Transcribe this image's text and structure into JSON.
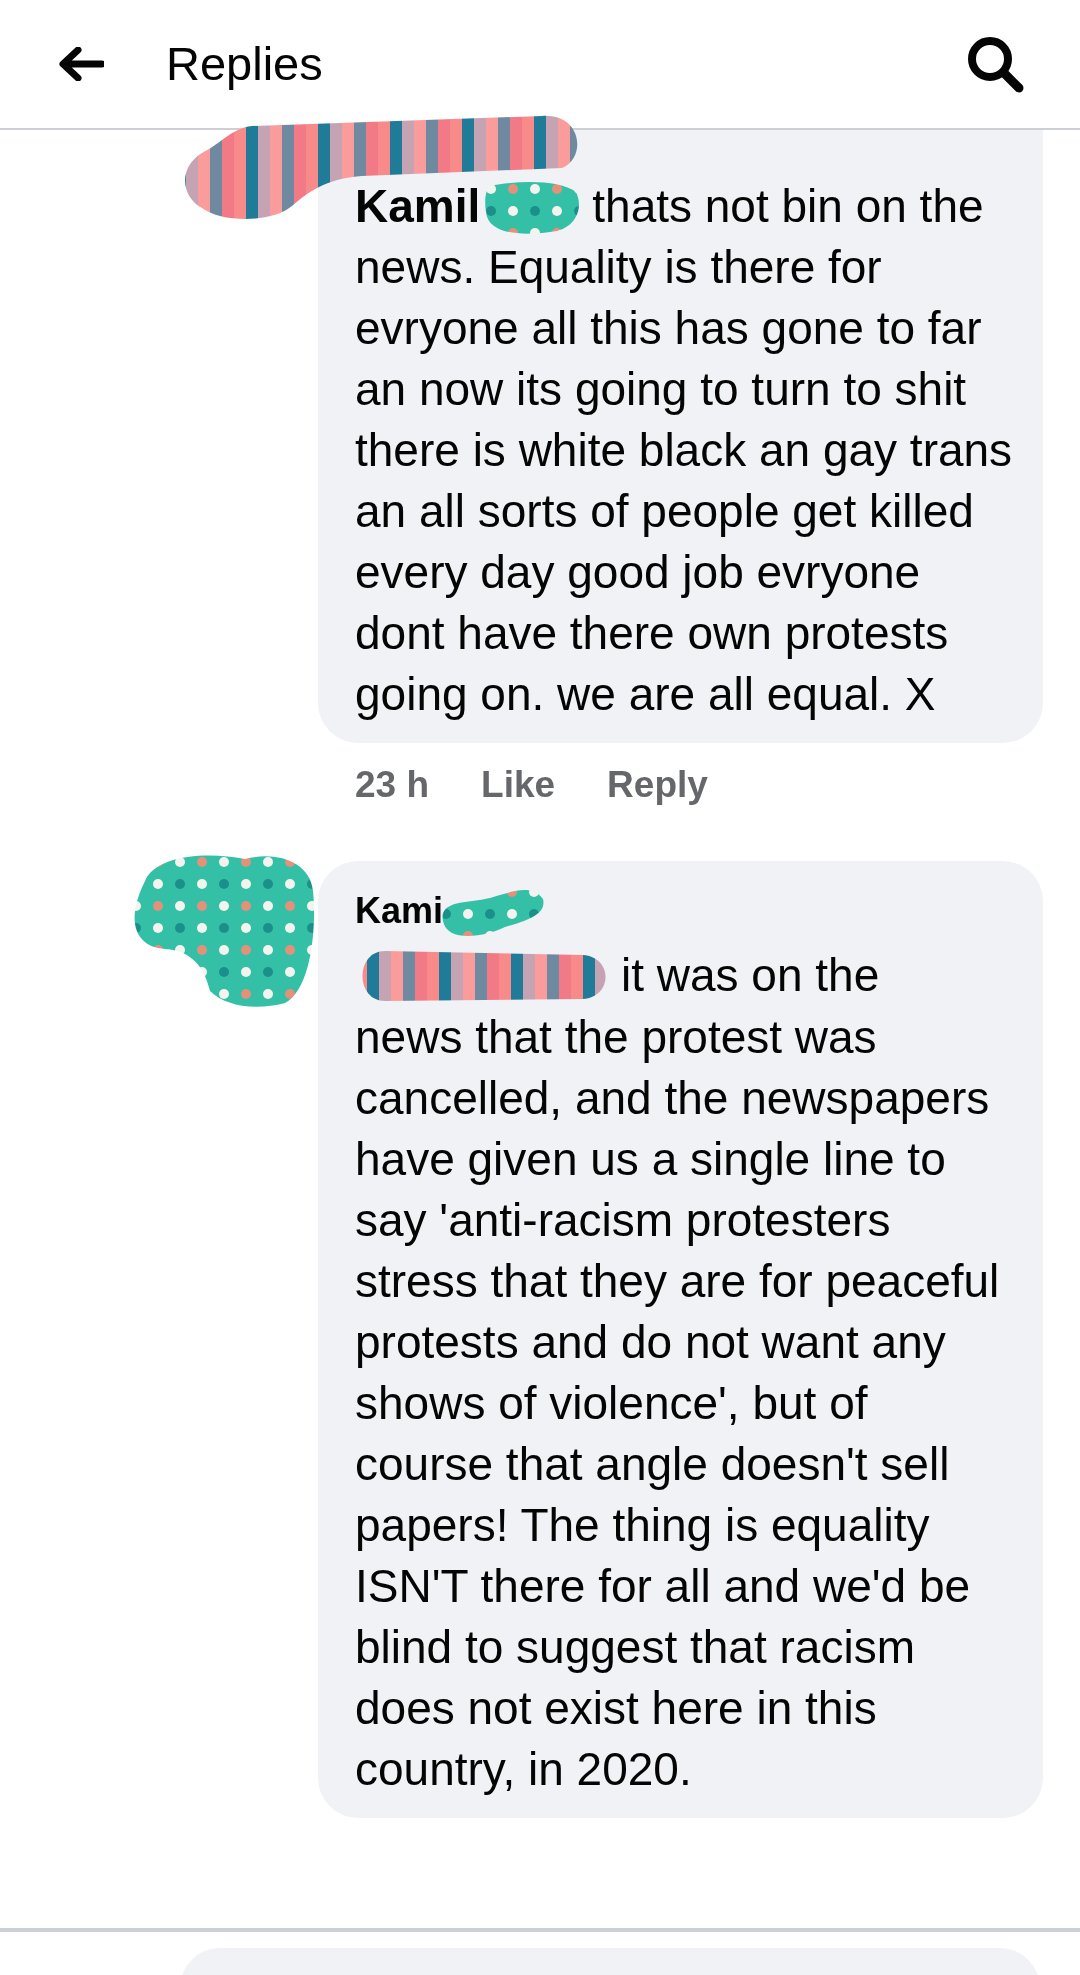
{
  "header": {
    "title": "Replies"
  },
  "comments": [
    {
      "mention": "Kamil",
      "lead": "thats not bin on the",
      "text": "news. Equality is there for evryone all this has gone to far an now its going to turn to shit there is white black an gay trans an all sorts of people get killed every day good job evryone dont have there own protests going on. we are all equal. X",
      "time": "23 h",
      "actions": [
        "Like",
        "Reply"
      ]
    },
    {
      "author": "Kami",
      "lead": "it was on the",
      "text": "news that the protest was cancelled, and the newspapers have given us a single line to say 'anti-racism protesters stress that they are for peaceful protests and do not want any shows of violence', but of course that angle doesn't sell papers! The thing is equality ISN'T there for all and we'd be blind to suggest that racism does not exist here in this country, in 2020."
    }
  ]
}
